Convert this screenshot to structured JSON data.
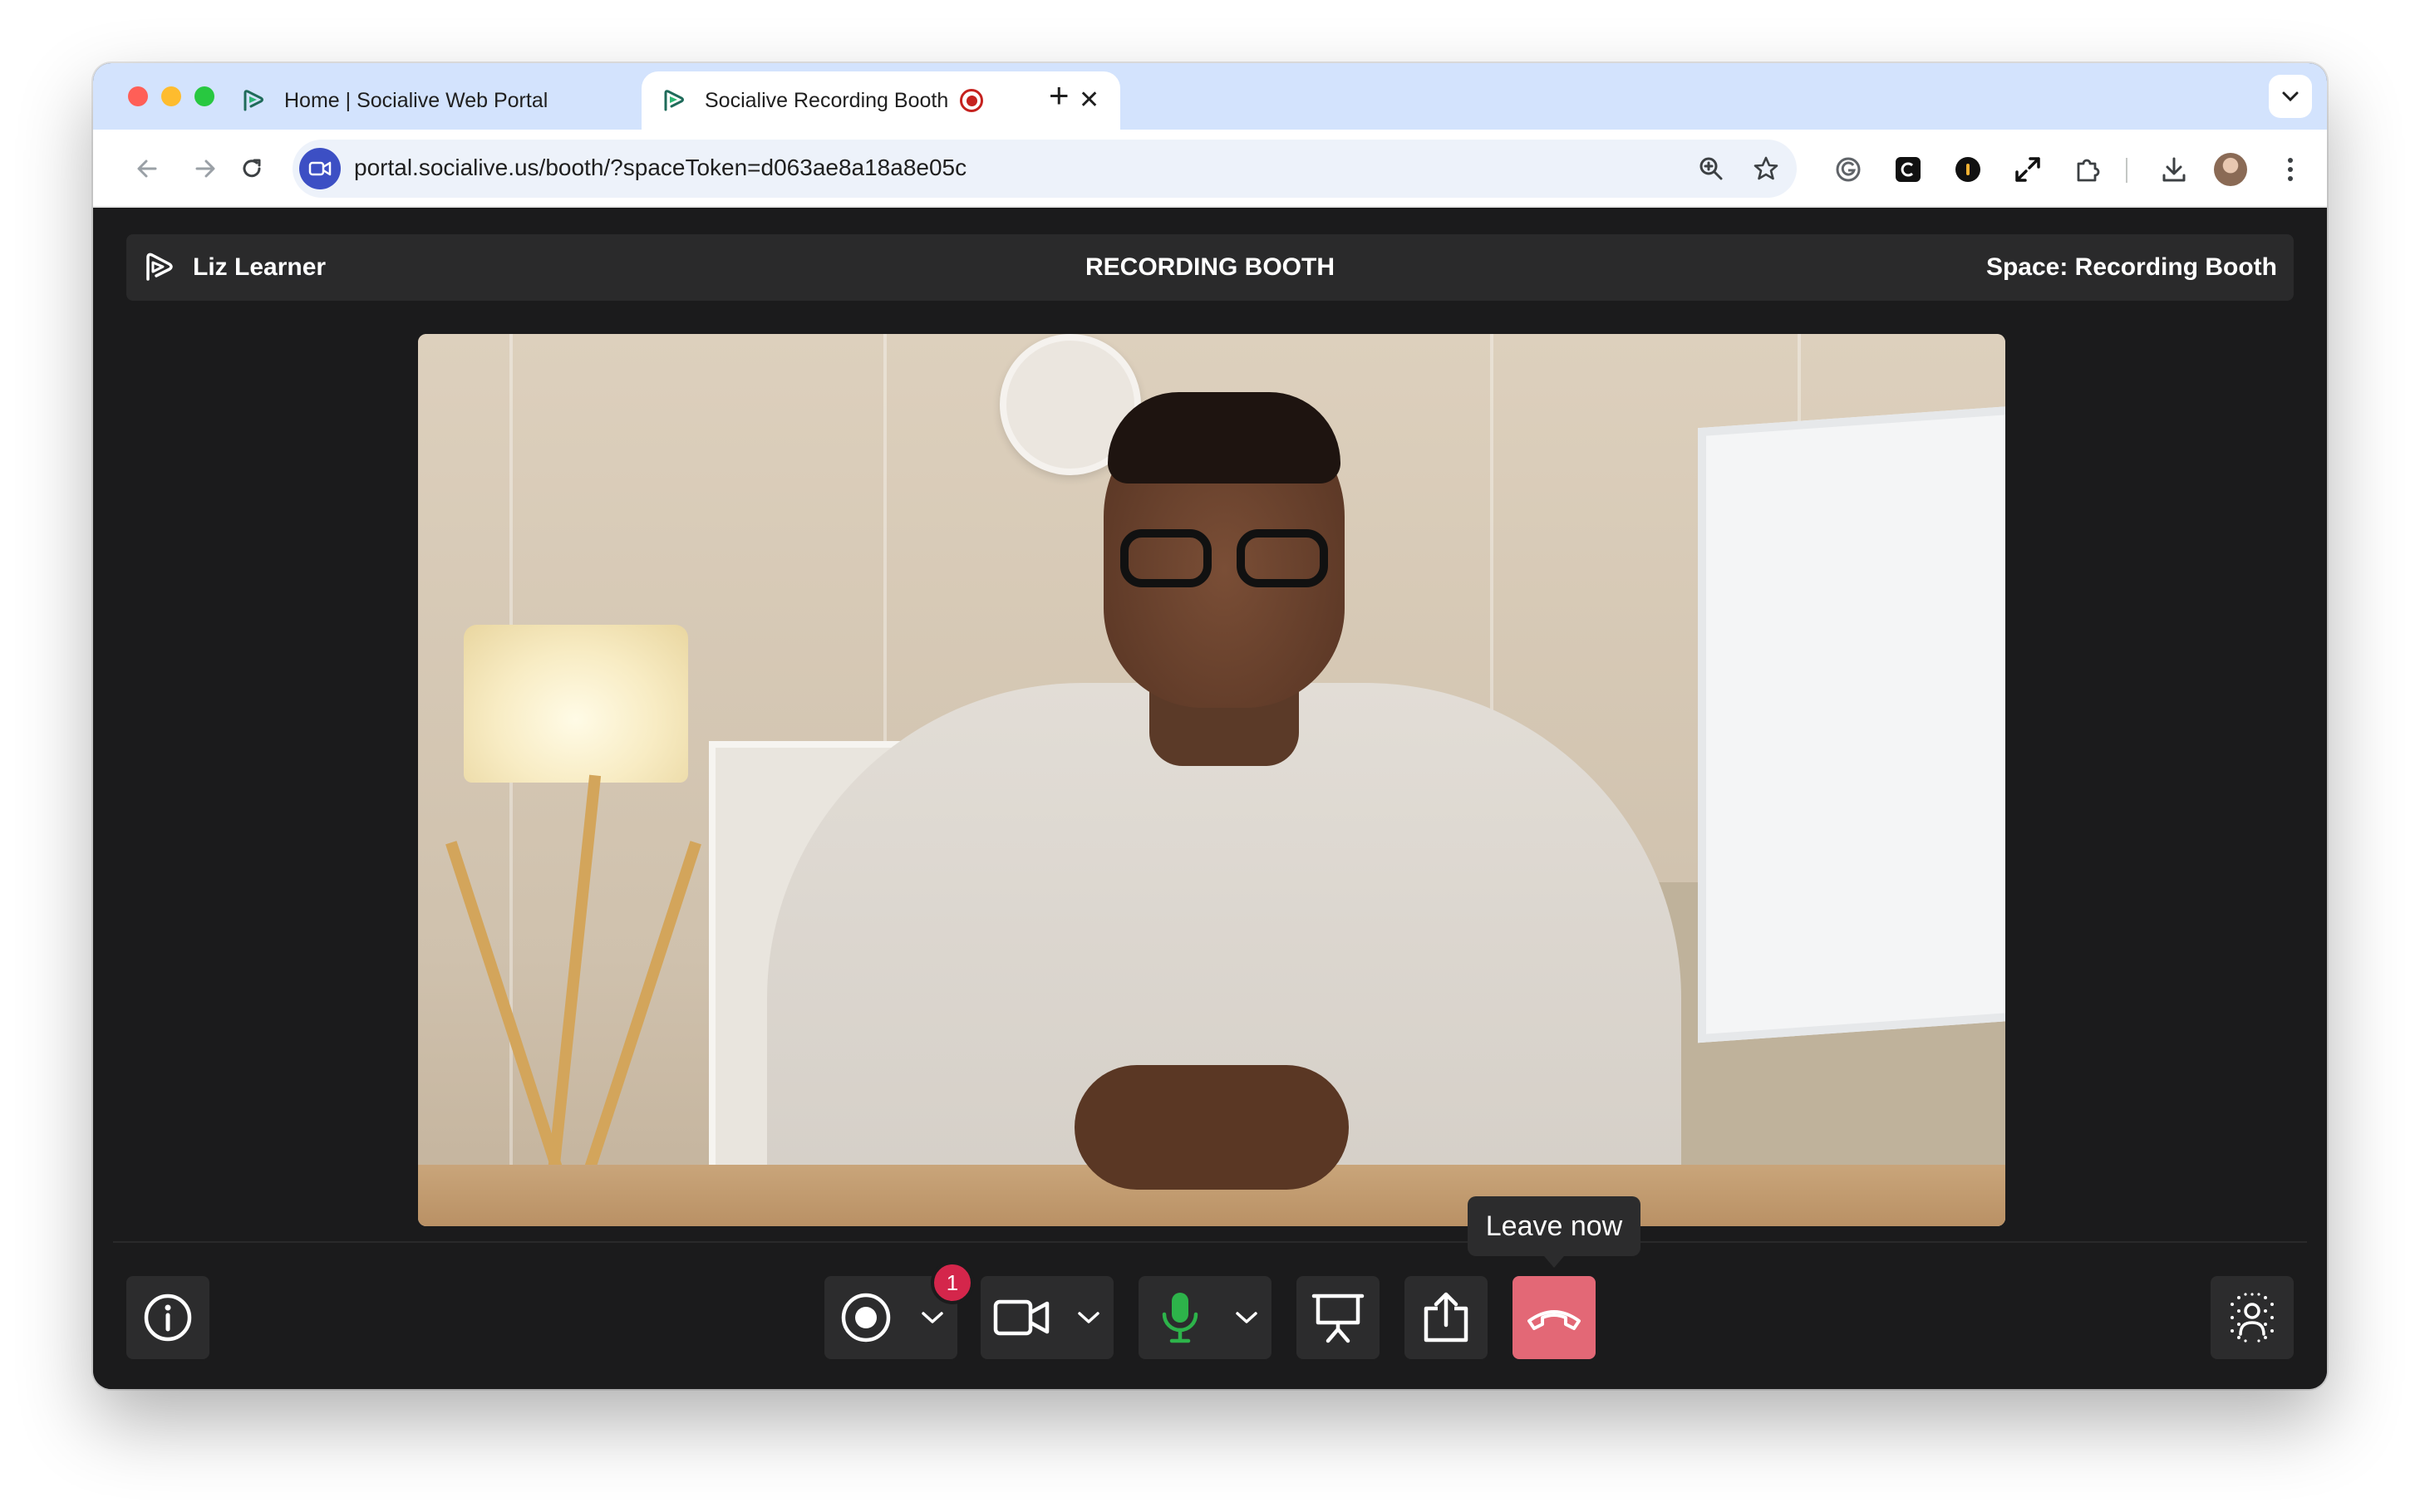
{
  "browser": {
    "tabs": [
      {
        "title": "Home | Socialive Web Portal",
        "active": false
      },
      {
        "title": "Socialive Recording Booth",
        "active": true,
        "recording": true
      }
    ],
    "url": "portal.socialive.us/booth/?spaceToken=d063ae8a18a8e05c",
    "close_glyph": "✕",
    "new_tab_glyph": "+"
  },
  "header": {
    "user_name": "Liz Learner",
    "title": "RECORDING BOOTH",
    "space": "Space: Recording Booth"
  },
  "controls": {
    "record_badge_count": "1",
    "leave_tooltip": "Leave now"
  },
  "colors": {
    "app_bg": "#1b1b1c",
    "header_bg": "#2a2a2b",
    "leave_red": "#e36876",
    "mic_green": "#2db34a",
    "badge_red": "#d4264b",
    "tab_strip": "#d3e3fd"
  },
  "icons": {
    "info": "info-icon",
    "record": "record-icon",
    "camera": "video-camera-icon",
    "mic": "microphone-icon",
    "present": "presentation-icon",
    "share": "share-upload-icon",
    "leave": "hang-up-phone-icon",
    "background": "background-blur-icon"
  }
}
